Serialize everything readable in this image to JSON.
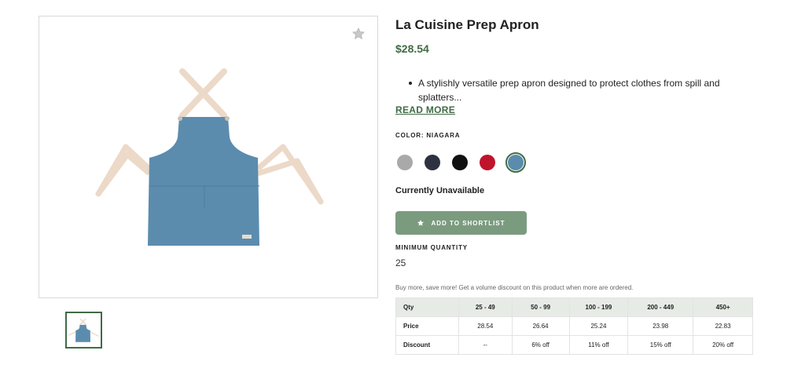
{
  "product": {
    "title": "La Cuisine Prep Apron",
    "price": "$28.54",
    "description": "A stylishly versatile prep apron designed to protect clothes from spill and splatters...",
    "read_more": "READ MORE",
    "color_label": "COLOR:",
    "selected_color": "NIAGARA",
    "availability": "Currently Unavailable",
    "shortlist_label": "ADD TO SHORTLIST",
    "min_qty_label": "MINIMUM QUANTITY",
    "min_qty_value": "25",
    "volume_note": "Buy more, save more! Get a volume discount on this product when more are ordered."
  },
  "swatches": [
    {
      "name": "gray",
      "color": "#a9a9a9",
      "selected": false
    },
    {
      "name": "charcoal",
      "color": "#2e3140",
      "selected": false
    },
    {
      "name": "black",
      "color": "#111111",
      "selected": false
    },
    {
      "name": "red",
      "color": "#c0142c",
      "selected": false
    },
    {
      "name": "niagara",
      "color": "#5b8cae",
      "selected": true
    }
  ],
  "icons": {
    "favorite": "star-icon",
    "shortlist": "star-icon"
  },
  "colors": {
    "brand_green": "#3f6b45",
    "button_green": "#7b9b7f",
    "table_header_bg": "#e6ebe6",
    "apron_blue": "#5b8cae",
    "strap_beige": "#ecd9c8"
  },
  "pricing_table": {
    "rows": [
      [
        "Qty",
        "25 - 49",
        "50 - 99",
        "100 - 199",
        "200 - 449",
        "450+"
      ],
      [
        "Price",
        "28.54",
        "26.64",
        "25.24",
        "23.98",
        "22.83"
      ],
      [
        "Discount",
        "--",
        "6% off",
        "11% off",
        "15% off",
        "20% off"
      ]
    ]
  }
}
